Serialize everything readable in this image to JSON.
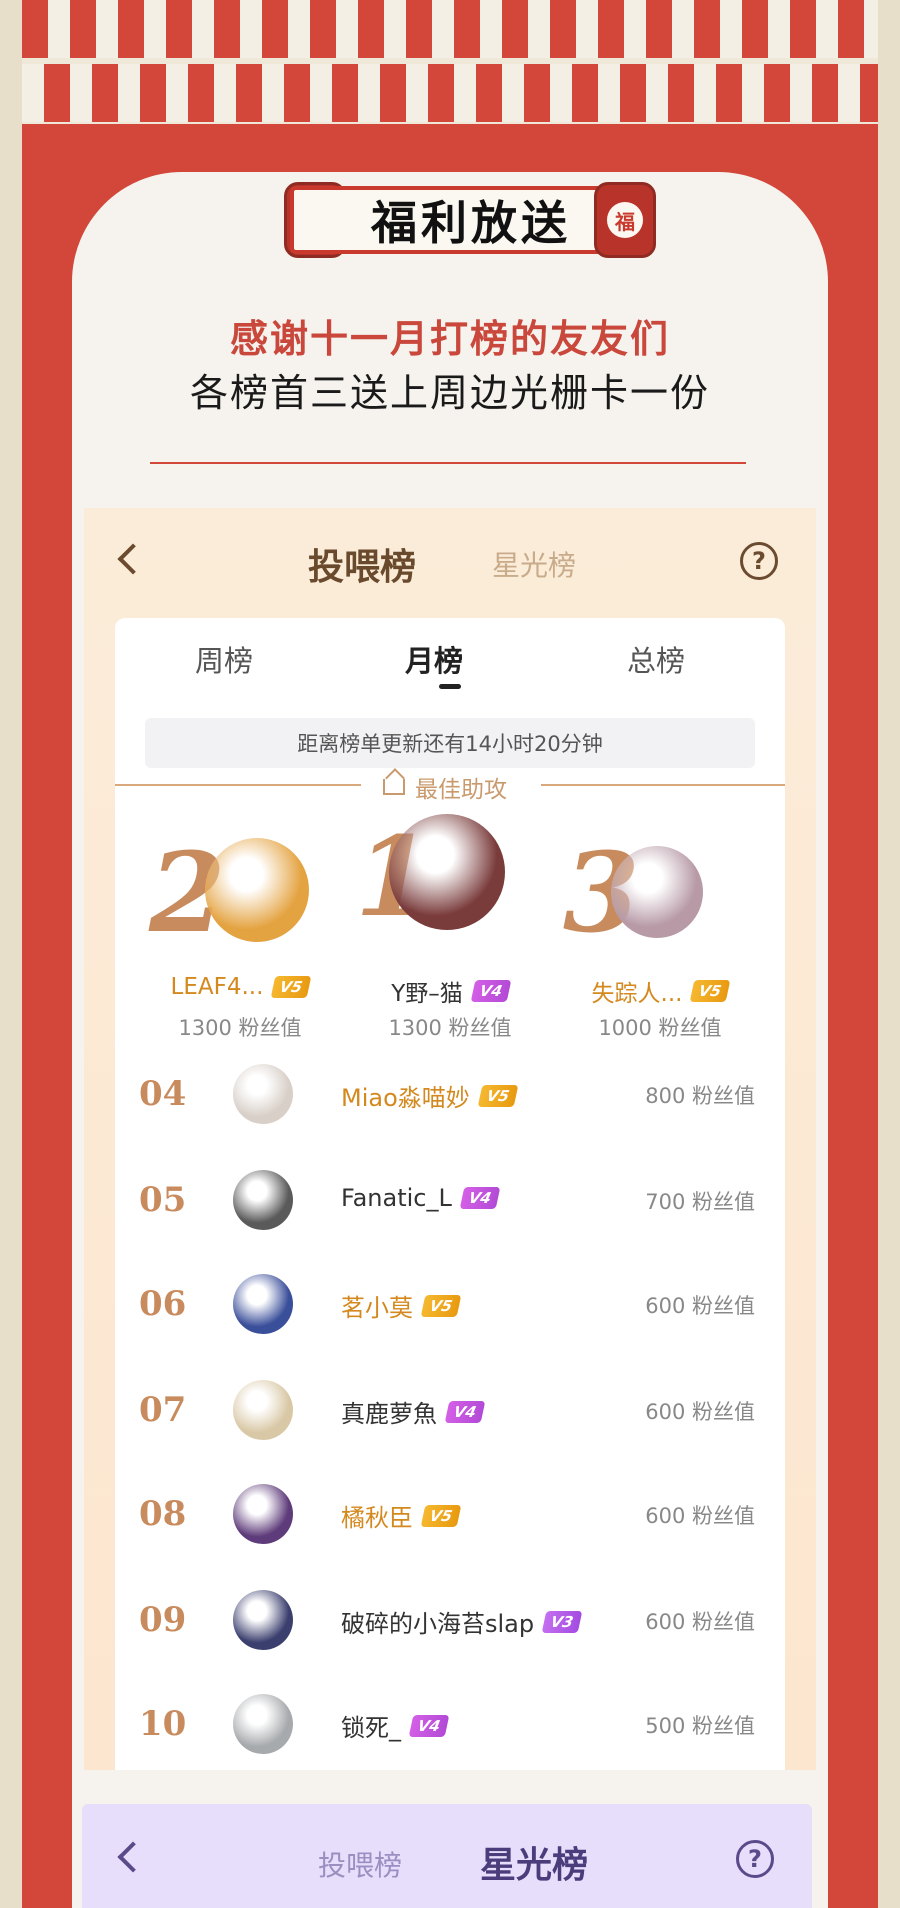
{
  "banner": {
    "fu_char": "福",
    "title": "福利放送"
  },
  "thanks": "感谢十一月打榜的友友们",
  "subtitle": "各榜首三送上周边光栅卡一份",
  "panel": {
    "tab_active": "投喂榜",
    "tab_other": "星光榜",
    "help": "?",
    "subtabs": [
      "周榜",
      "月榜",
      "总榜"
    ],
    "active_subtab": "月榜",
    "notice": "距离榜单更新还有14小时20分钟",
    "section_label": "最佳助攻",
    "podium": [
      {
        "rank": "2",
        "name": "LEAF4...",
        "badge": "V5",
        "value": "1300 粉丝值",
        "color": "#e4a341"
      },
      {
        "rank": "1",
        "name": "Y野–猫",
        "badge": "V4",
        "value": "1300 粉丝值",
        "color": "#7a3b3b"
      },
      {
        "rank": "3",
        "name": "失踪人...",
        "badge": "V5",
        "value": "1000 粉丝值",
        "color": "#b79aa6"
      }
    ],
    "list": [
      {
        "rank": "04",
        "name": "Miao淼喵妙",
        "badge": "V5",
        "value": "800 粉丝值",
        "gold": true,
        "color": "#d8cfc8"
      },
      {
        "rank": "05",
        "name": "Fanatic_L",
        "badge": "V4",
        "value": "700 粉丝值",
        "gold": false,
        "color": "#5a5a5a"
      },
      {
        "rank": "06",
        "name": "茗小莫",
        "badge": "V5",
        "value": "600 粉丝值",
        "gold": true,
        "color": "#3a4f9a"
      },
      {
        "rank": "07",
        "name": "真鹿萝魚",
        "badge": "V4",
        "value": "600 粉丝值",
        "gold": false,
        "color": "#d9c8a6"
      },
      {
        "rank": "08",
        "name": "橘秋臣",
        "badge": "V5",
        "value": "600 粉丝值",
        "gold": true,
        "color": "#5e3b7a"
      },
      {
        "rank": "09",
        "name": "破碎的小海苔slap",
        "badge": "V3",
        "value": "600 粉丝值",
        "gold": false,
        "color": "#3b3f6e"
      },
      {
        "rank": "10",
        "name": "锁死_",
        "badge": "V4",
        "value": "500 粉丝值",
        "gold": false,
        "color": "#a7aaad"
      }
    ]
  },
  "bottom": {
    "tab_other": "投喂榜",
    "tab_active": "星光榜",
    "help": "?"
  }
}
